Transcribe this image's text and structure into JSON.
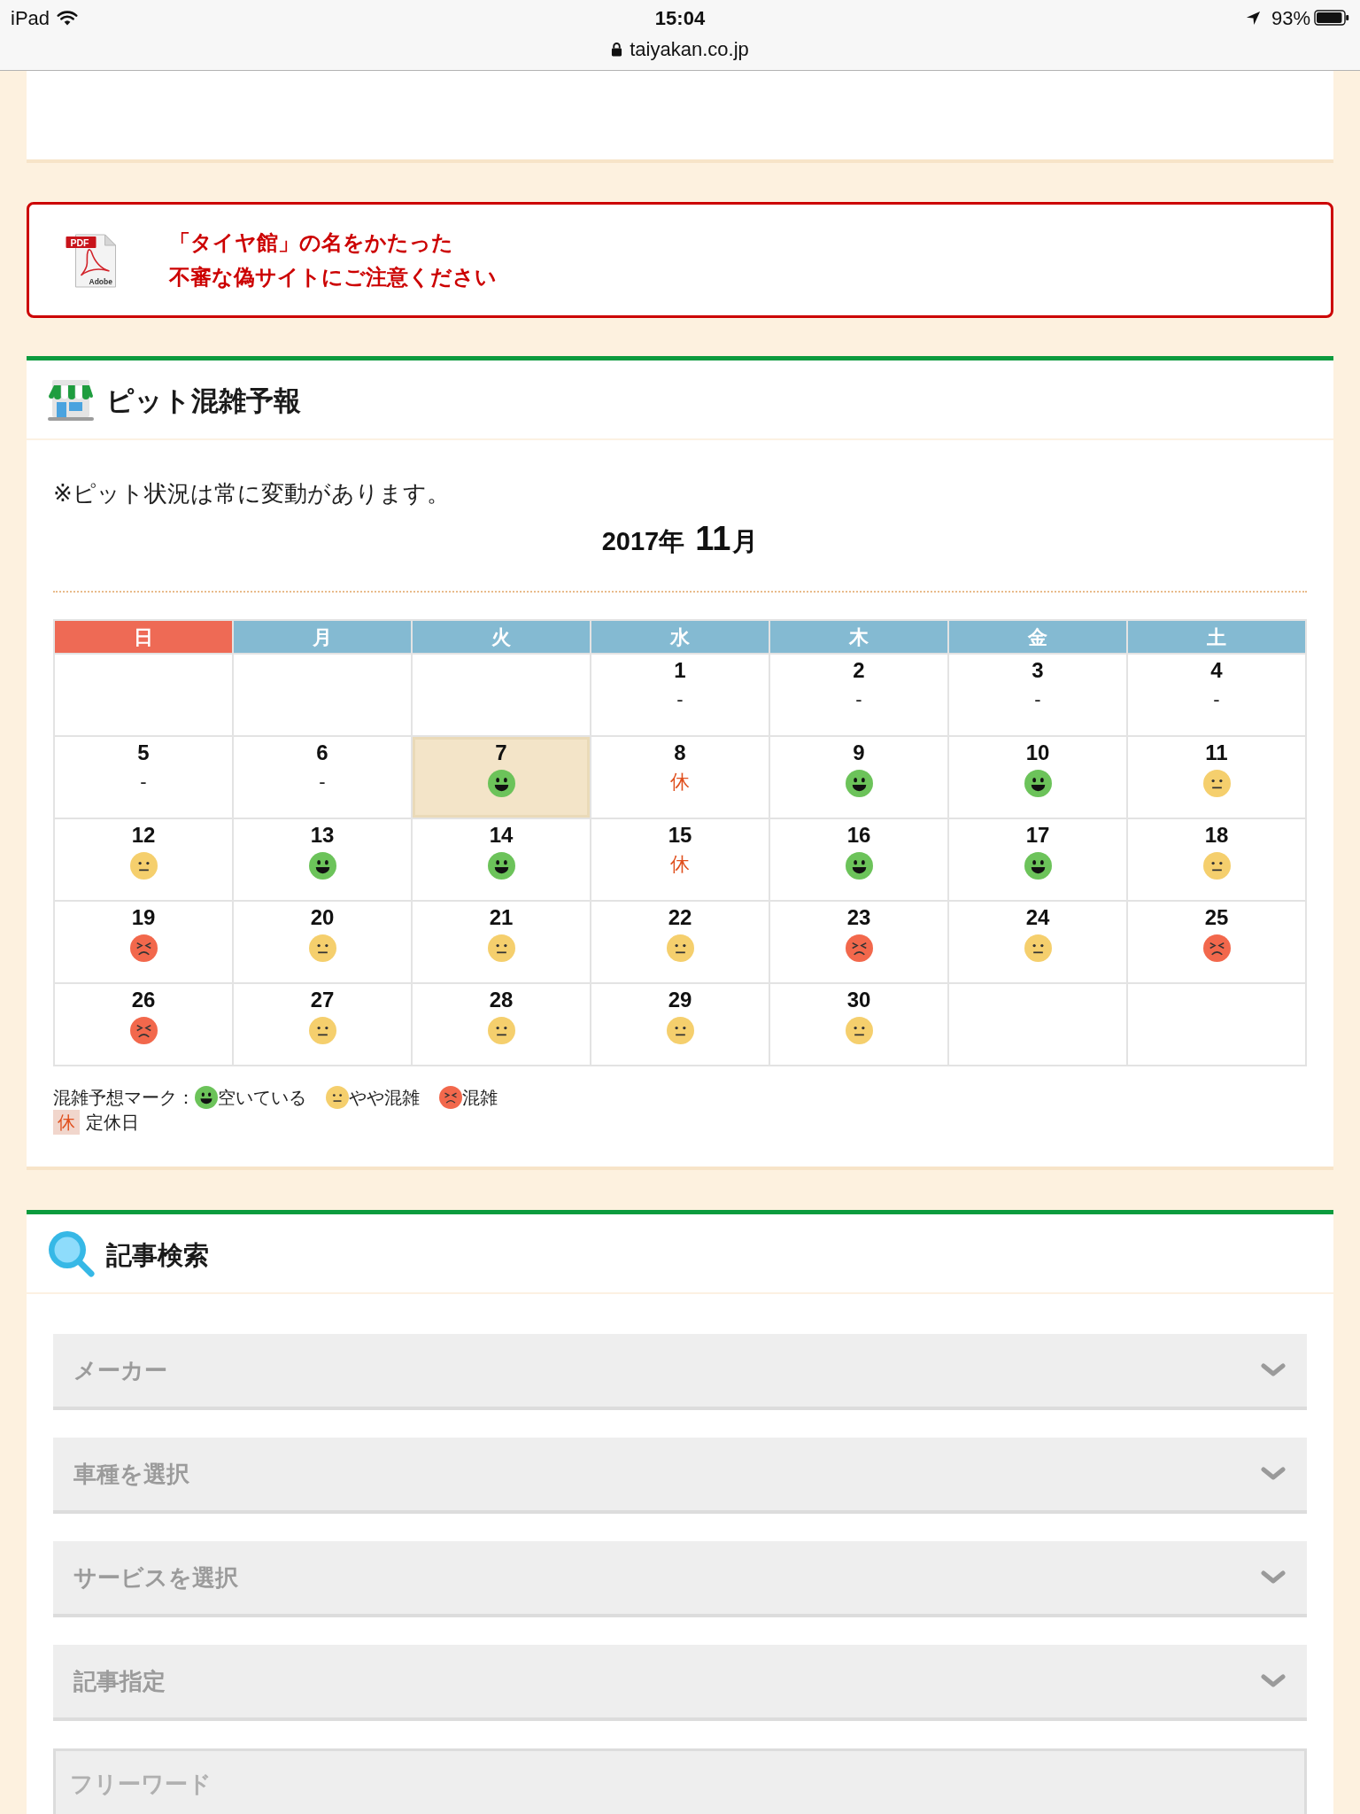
{
  "status_bar": {
    "device": "iPad",
    "time": "15:04",
    "battery": "93%",
    "url": "taiyakan.co.jp"
  },
  "notice": {
    "icon_badge": "PDF",
    "icon_caption": "Adobe",
    "lines": [
      "「タイヤ館」の名をかたった",
      "不審な偽サイトにご注意ください"
    ]
  },
  "pit_forecast": {
    "title": "ピット混雑予報",
    "note": "※ピット状況は常に変動があります。",
    "year": "2017年",
    "month_number": "11",
    "month_suffix": "月",
    "weekdays": [
      {
        "label": "日",
        "color": "#ee6a55"
      },
      {
        "label": "月",
        "color": "#84bad2"
      },
      {
        "label": "火",
        "color": "#84bad2"
      },
      {
        "label": "水",
        "color": "#84bad2"
      },
      {
        "label": "木",
        "color": "#84bad2"
      },
      {
        "label": "金",
        "color": "#84bad2"
      },
      {
        "label": "土",
        "color": "#84bad2"
      }
    ],
    "weeks": [
      {
        "days": [
          {
            "kind": "blank",
            "today": false
          },
          {
            "kind": "blank",
            "today": false
          },
          {
            "kind": "blank",
            "today": false
          },
          {
            "day": "1",
            "kind": "none",
            "text": "-",
            "today": false
          },
          {
            "day": "2",
            "kind": "none",
            "text": "-",
            "today": false
          },
          {
            "day": "3",
            "kind": "none",
            "text": "-",
            "today": false
          },
          {
            "day": "4",
            "kind": "none",
            "text": "-",
            "today": false
          }
        ]
      },
      {
        "days": [
          {
            "day": "5",
            "kind": "none",
            "text": "-",
            "today": false
          },
          {
            "day": "6",
            "kind": "none",
            "text": "-",
            "today": false
          },
          {
            "day": "7",
            "kind": "vacant",
            "today": true
          },
          {
            "day": "8",
            "kind": "closed",
            "text": "休",
            "today": false
          },
          {
            "day": "9",
            "kind": "vacant",
            "today": false
          },
          {
            "day": "10",
            "kind": "vacant",
            "today": false
          },
          {
            "day": "11",
            "kind": "moderate",
            "today": false
          }
        ]
      },
      {
        "days": [
          {
            "day": "12",
            "kind": "moderate",
            "today": false
          },
          {
            "day": "13",
            "kind": "vacant",
            "today": false
          },
          {
            "day": "14",
            "kind": "vacant",
            "today": false
          },
          {
            "day": "15",
            "kind": "closed",
            "text": "休",
            "today": false
          },
          {
            "day": "16",
            "kind": "vacant",
            "today": false
          },
          {
            "day": "17",
            "kind": "vacant",
            "today": false
          },
          {
            "day": "18",
            "kind": "moderate",
            "today": false
          }
        ]
      },
      {
        "days": [
          {
            "day": "19",
            "kind": "crowded",
            "today": false
          },
          {
            "day": "20",
            "kind": "moderate",
            "today": false
          },
          {
            "day": "21",
            "kind": "moderate",
            "today": false
          },
          {
            "day": "22",
            "kind": "moderate",
            "today": false
          },
          {
            "day": "23",
            "kind": "crowded",
            "today": false
          },
          {
            "day": "24",
            "kind": "moderate",
            "today": false
          },
          {
            "day": "25",
            "kind": "crowded",
            "today": false
          }
        ]
      },
      {
        "days": [
          {
            "day": "26",
            "kind": "crowded",
            "today": false
          },
          {
            "day": "27",
            "kind": "moderate",
            "today": false
          },
          {
            "day": "28",
            "kind": "moderate",
            "today": false
          },
          {
            "day": "29",
            "kind": "moderate",
            "today": false
          },
          {
            "day": "30",
            "kind": "moderate",
            "today": false
          },
          {
            "kind": "blank",
            "today": false
          },
          {
            "kind": "blank",
            "today": false
          }
        ]
      }
    ],
    "legend": {
      "title": "混雑予想マーク：",
      "items": [
        {
          "kind": "vacant",
          "label": "空いている"
        },
        {
          "kind": "moderate",
          "label": "やや混雑"
        },
        {
          "kind": "crowded",
          "label": "混雑"
        }
      ],
      "closed": {
        "mark": "休",
        "label": "定休日"
      }
    }
  },
  "article_search": {
    "title": "記事検索",
    "selects": [
      {
        "placeholder": "メーカー"
      },
      {
        "placeholder": "車種を選択"
      },
      {
        "placeholder": "サービスを選択"
      },
      {
        "placeholder": "記事指定"
      }
    ],
    "free_word": {
      "placeholder": "フリーワード"
    }
  }
}
